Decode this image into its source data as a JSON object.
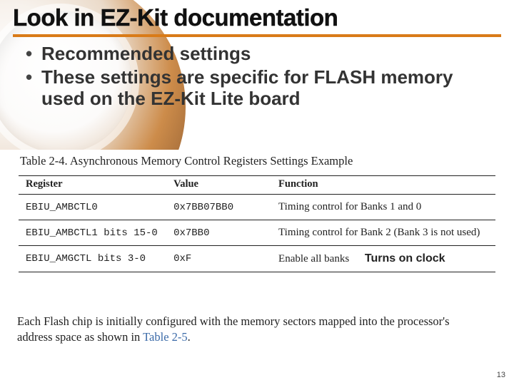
{
  "title": "Look in EZ-Kit documentation",
  "bullets": [
    "Recommended settings",
    "These settings are specific for FLASH memory used on the EZ-Kit Lite board"
  ],
  "table": {
    "caption": "Table 2-4. Asynchronous Memory Control Registers Settings Example",
    "headers": [
      "Register",
      "Value",
      "Function"
    ],
    "rows": [
      {
        "register": "EBIU_AMBCTL0",
        "value": "0x7BB07BB0",
        "function": "Timing control for Banks 1 and 0"
      },
      {
        "register": "EBIU_AMBCTL1 bits 15-0",
        "value": "0x7BB0",
        "function": "Timing control for Bank 2 (Bank 3 is not used)"
      },
      {
        "register": "EBIU_AMGCTL bits 3-0",
        "value": "0xF",
        "function": "Enable all banks"
      }
    ]
  },
  "annotation": "Turns on clock",
  "paragraph_after": {
    "text": "Each Flash chip is initially configured with the memory sectors mapped into the processor's address space as shown in ",
    "link": "Table 2-5",
    "suffix": "."
  },
  "page_number": "13"
}
